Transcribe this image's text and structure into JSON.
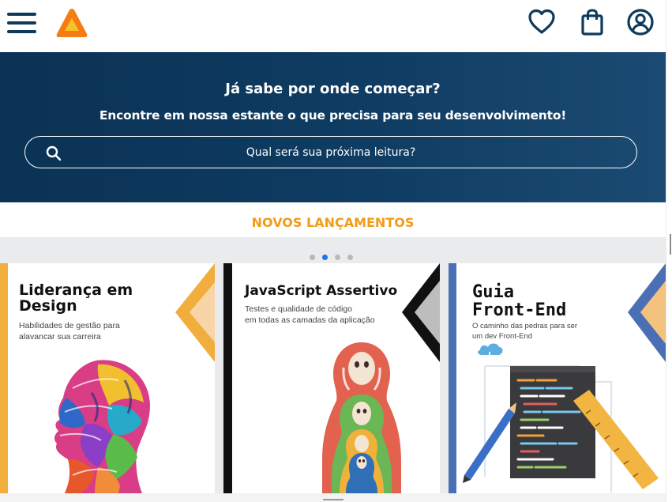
{
  "header": {
    "menu_icon": "hamburger-menu-icon",
    "logo_icon": "triangle-logo",
    "actions": [
      "heart-icon",
      "shopping-bag-icon",
      "user-account-icon"
    ]
  },
  "hero": {
    "title": "Já sabe por onde começar?",
    "subtitle": "Encontre em nossa estante o que precisa para seu desenvolvimento!",
    "search_placeholder": "Qual será sua próxima leitura?",
    "search_icon": "search-icon"
  },
  "section": {
    "title": "NOVOS LANÇAMENTOS"
  },
  "carousel": {
    "dot_count": 4,
    "active_index": 1
  },
  "books": [
    {
      "title_line1": "Liderança em",
      "title_line2": "Design",
      "sub_line1": "Habilidades de gestão para",
      "sub_line2": "alavancar sua carreira"
    },
    {
      "title_line1": "JavaScript Assertivo",
      "title_line2": "",
      "sub_line1": "Testes e qualidade de código",
      "sub_line2": "em todas as camadas da aplicação"
    },
    {
      "title_line1": "Guia",
      "title_line2": "Front-End",
      "sub_line1": "O caminho das pedras para ser",
      "sub_line2": "um dev Front-End"
    }
  ],
  "colors": {
    "navy": "#0e3a5c",
    "orange": "#f29b17",
    "active_dot": "#1677e6"
  }
}
